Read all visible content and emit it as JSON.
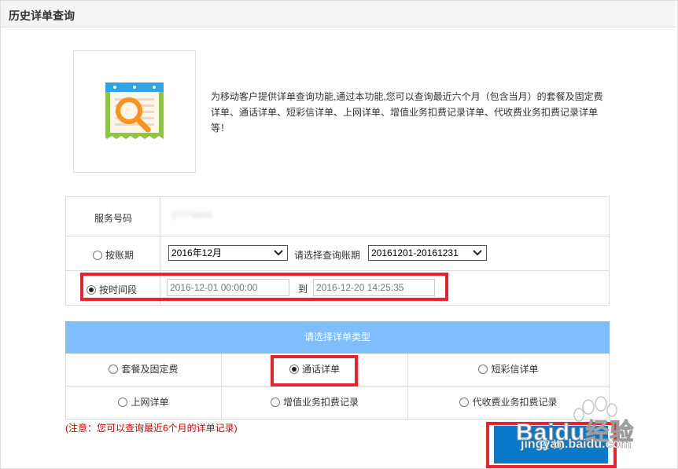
{
  "header": {
    "title": "历史详单查询"
  },
  "intro": {
    "text": "为移动客户提供详单查询功能,通过本功能,您可以查询最近六个月（包含当月）的套餐及固定费详单、通话详单、短彩信详单、上网详单、增值业务扣费记录详单、代收费业务扣费记录详单等！"
  },
  "form": {
    "service_number": {
      "label": "服务号码",
      "value": "1****4444"
    },
    "by_period": {
      "label": "按账期",
      "month_select": "2016年12月",
      "prompt": "请选择查询账期",
      "period_select": "20161201-20161231"
    },
    "by_time": {
      "label": "按时间段",
      "start": "2016-12-01 00:00:00",
      "to": "到",
      "end": "2016-12-20 14:25:35"
    }
  },
  "types": {
    "header": "请选择详单类型",
    "options": [
      {
        "label": "套餐及固定费",
        "checked": false
      },
      {
        "label": "通话详单",
        "checked": true
      },
      {
        "label": "短彩信详单",
        "checked": false
      },
      {
        "label": "上网详单",
        "checked": false
      },
      {
        "label": "增值业务扣费记录",
        "checked": false
      },
      {
        "label": "代收费业务扣费记录",
        "checked": false
      }
    ]
  },
  "notice": "(注意：您可以查询最近6个月的详单记录)",
  "query_button": "查 询",
  "watermark": {
    "brand": "Baidu经验",
    "url": "jingyan.baidu.com"
  },
  "colors": {
    "type_header_bg": "#80bdfd",
    "button_bg": "#0a78c8",
    "highlight": "#e8232f",
    "notice": "#d40000",
    "icon_green": "#8dc63f",
    "icon_blue": "#2fa4e7",
    "icon_orange": "#f7941d"
  }
}
